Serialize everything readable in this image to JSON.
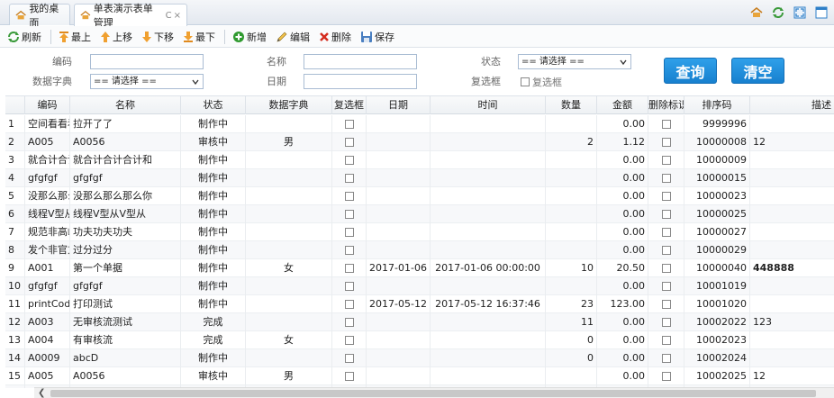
{
  "tabs": [
    {
      "label": "我的桌面",
      "active": false
    },
    {
      "label": "单表演示表单管理",
      "active": true,
      "refresh_glyph": "C",
      "close_glyph": "×"
    }
  ],
  "toolbar": {
    "refresh": "刷新",
    "top": "最上",
    "up": "上移",
    "down": "下移",
    "bottom": "最下",
    "add": "新增",
    "edit": "编辑",
    "delete": "删除",
    "save": "保存"
  },
  "form": {
    "code_label": "编码",
    "name_label": "名称",
    "status_label": "状态",
    "dict_label": "数据字典",
    "date_label": "日期",
    "checkbox_label": "复选框",
    "checkbox_text": "复选框",
    "status_value": "== 请选择 ==",
    "dict_value": "== 请选择 ==",
    "query_button": "查询",
    "clear_button": "清空"
  },
  "grid": {
    "columns": [
      "",
      "编码",
      "名称",
      "状态",
      "数据字典",
      "复选框",
      "日期",
      "时间",
      "数量",
      "金额",
      "删除标识",
      "排序码",
      "描述"
    ],
    "rows": [
      {
        "n": "1",
        "code": "空间看看看",
        "name": "拉开了了",
        "status": "制作中",
        "dict": "",
        "date": "",
        "time": "",
        "qty": "",
        "amount": "0.00",
        "sort": "9999996",
        "desc": ""
      },
      {
        "n": "2",
        "code": "A005",
        "name": "A0056",
        "status": "审核中",
        "dict": "男",
        "date": "",
        "time": "",
        "qty": "2",
        "amount": "1.12",
        "sort": "10000008",
        "desc": "12"
      },
      {
        "n": "3",
        "code": "就合计合计",
        "name": "就合计合计合计和",
        "status": "制作中",
        "dict": "",
        "date": "",
        "time": "",
        "qty": "",
        "amount": "0.00",
        "sort": "10000009",
        "desc": ""
      },
      {
        "n": "4",
        "code": "gfgfgf",
        "name": "gfgfgf",
        "status": "制作中",
        "dict": "",
        "date": "",
        "time": "",
        "qty": "",
        "amount": "0.00",
        "sort": "10000015",
        "desc": ""
      },
      {
        "n": "5",
        "code": "没那么那么",
        "name": "没那么那么那么你",
        "status": "制作中",
        "dict": "",
        "date": "",
        "time": "",
        "qty": "",
        "amount": "0.00",
        "sort": "10000023",
        "desc": ""
      },
      {
        "n": "6",
        "code": "线程V型从",
        "name": "线程V型从V型从",
        "status": "制作中",
        "dict": "",
        "date": "",
        "time": "",
        "qty": "",
        "amount": "0.00",
        "sort": "10000025",
        "desc": ""
      },
      {
        "n": "7",
        "code": "规范非高峰",
        "name": "功夫功夫功夫",
        "status": "制作中",
        "dict": "",
        "date": "",
        "time": "",
        "qty": "",
        "amount": "0.00",
        "sort": "10000027",
        "desc": ""
      },
      {
        "n": "8",
        "code": "发个非官方",
        "name": "过分过分",
        "status": "制作中",
        "dict": "",
        "date": "",
        "time": "",
        "qty": "",
        "amount": "0.00",
        "sort": "10000029",
        "desc": ""
      },
      {
        "n": "9",
        "code": "A001",
        "name": "第一个单据",
        "status": "制作中",
        "dict": "女",
        "date": "2017-01-06",
        "time": "2017-01-06 00:00:00",
        "qty": "10",
        "amount": "20.50",
        "sort": "10000040",
        "desc": "448888"
      },
      {
        "n": "10",
        "code": "gfgfgf",
        "name": "gfgfgf",
        "status": "制作中",
        "dict": "",
        "date": "",
        "time": "",
        "qty": "",
        "amount": "0.00",
        "sort": "10001019",
        "desc": ""
      },
      {
        "n": "11",
        "code": "printCode",
        "name": "打印测试",
        "status": "制作中",
        "dict": "",
        "date": "2017-05-12",
        "time": "2017-05-12 16:37:46",
        "qty": "23",
        "amount": "123.00",
        "sort": "10001020",
        "desc": ""
      },
      {
        "n": "12",
        "code": "A003",
        "name": "无审核流测试",
        "status": "完成",
        "dict": "",
        "date": "",
        "time": "",
        "qty": "11",
        "amount": "0.00",
        "sort": "10002022",
        "desc": "123"
      },
      {
        "n": "13",
        "code": "A004",
        "name": "有审核流",
        "status": "完成",
        "dict": "女",
        "date": "",
        "time": "",
        "qty": "0",
        "amount": "0.00",
        "sort": "10002023",
        "desc": ""
      },
      {
        "n": "14",
        "code": "A0009",
        "name": "abcD",
        "status": "制作中",
        "dict": "",
        "date": "",
        "time": "",
        "qty": "0",
        "amount": "0.00",
        "sort": "10002024",
        "desc": ""
      },
      {
        "n": "15",
        "code": "A005",
        "name": "A0056",
        "status": "审核中",
        "dict": "男",
        "date": "",
        "time": "",
        "qty": "",
        "amount": "0.00",
        "sort": "10002025",
        "desc": "12"
      },
      {
        "n": "16",
        "code": "",
        "name": "",
        "status": "",
        "dict": "",
        "date": "",
        "time": "",
        "qty": "",
        "amount": "",
        "sort": "",
        "desc": ""
      }
    ]
  },
  "colors": {
    "accent": "#1a86d4",
    "tab_border": "#c5d1df"
  }
}
